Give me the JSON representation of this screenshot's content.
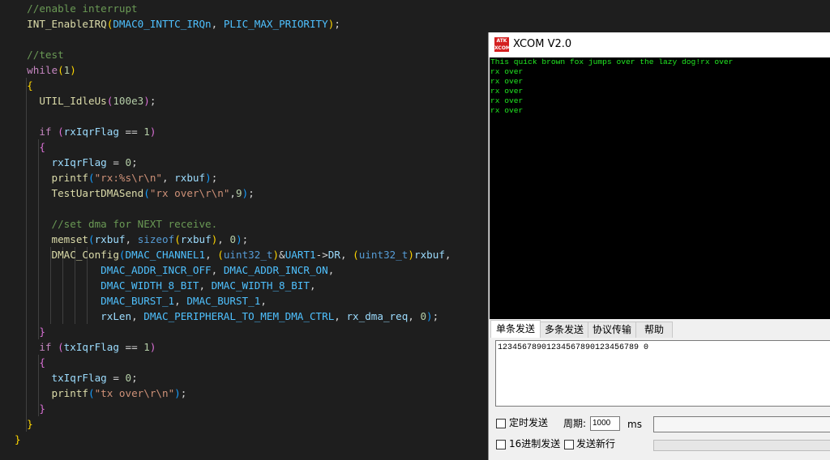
{
  "editor": {
    "lines": [
      [
        {
          "t": "  //enable interrupt",
          "c": "cm"
        }
      ],
      [
        {
          "t": "  INT_EnableIRQ",
          "c": "fn"
        },
        {
          "t": "(",
          "c": "b1"
        },
        {
          "t": "DMAC0_INTTC_IRQn",
          "c": "mac"
        },
        {
          "t": ", ",
          "c": "pl"
        },
        {
          "t": "PLIC_MAX_PRIORITY",
          "c": "mac"
        },
        {
          "t": ")",
          "c": "b1"
        },
        {
          "t": ";",
          "c": "pl"
        }
      ],
      [],
      [
        {
          "t": "  //test",
          "c": "cm"
        }
      ],
      [
        {
          "t": "  while",
          "c": "kw"
        },
        {
          "t": "(",
          "c": "b1"
        },
        {
          "t": "1",
          "c": "num"
        },
        {
          "t": ")",
          "c": "b1"
        }
      ],
      [
        {
          "t": "  {",
          "c": "b1"
        }
      ],
      [
        {
          "t": "    UTIL_IdleUs",
          "c": "fn"
        },
        {
          "t": "(",
          "c": "b2"
        },
        {
          "t": "100e3",
          "c": "num"
        },
        {
          "t": ")",
          "c": "b2"
        },
        {
          "t": ";",
          "c": "pl"
        }
      ],
      [],
      [
        {
          "t": "    if ",
          "c": "kw"
        },
        {
          "t": "(",
          "c": "b2"
        },
        {
          "t": "rxIqrFlag",
          "c": "var"
        },
        {
          "t": " == ",
          "c": "pl"
        },
        {
          "t": "1",
          "c": "num"
        },
        {
          "t": ")",
          "c": "b2"
        }
      ],
      [
        {
          "t": "    {",
          "c": "b2"
        }
      ],
      [
        {
          "t": "      rxIqrFlag",
          "c": "var"
        },
        {
          "t": " = ",
          "c": "pl"
        },
        {
          "t": "0",
          "c": "num"
        },
        {
          "t": ";",
          "c": "pl"
        }
      ],
      [
        {
          "t": "      printf",
          "c": "fn"
        },
        {
          "t": "(",
          "c": "b3"
        },
        {
          "t": "\"rx:%s\\r\\n\"",
          "c": "str"
        },
        {
          "t": ", ",
          "c": "pl"
        },
        {
          "t": "rxbuf",
          "c": "var"
        },
        {
          "t": ")",
          "c": "b3"
        },
        {
          "t": ";",
          "c": "pl"
        }
      ],
      [
        {
          "t": "      TestUartDMASend",
          "c": "fn"
        },
        {
          "t": "(",
          "c": "b3"
        },
        {
          "t": "\"rx over\\r\\n\"",
          "c": "str"
        },
        {
          "t": ",",
          "c": "pl"
        },
        {
          "t": "9",
          "c": "num"
        },
        {
          "t": ")",
          "c": "b3"
        },
        {
          "t": ";",
          "c": "pl"
        }
      ],
      [],
      [
        {
          "t": "      //set dma for NEXT receive.",
          "c": "cm"
        }
      ],
      [
        {
          "t": "      memset",
          "c": "fn"
        },
        {
          "t": "(",
          "c": "b3"
        },
        {
          "t": "rxbuf",
          "c": "var"
        },
        {
          "t": ", ",
          "c": "pl"
        },
        {
          "t": "sizeof",
          "c": "ty"
        },
        {
          "t": "(",
          "c": "b1"
        },
        {
          "t": "rxbuf",
          "c": "var"
        },
        {
          "t": ")",
          "c": "b1"
        },
        {
          "t": ", ",
          "c": "pl"
        },
        {
          "t": "0",
          "c": "num"
        },
        {
          "t": ")",
          "c": "b3"
        },
        {
          "t": ";",
          "c": "pl"
        }
      ],
      [
        {
          "t": "      DMAC_Config",
          "c": "fn"
        },
        {
          "t": "(",
          "c": "b3"
        },
        {
          "t": "DMAC_CHANNEL1",
          "c": "mac"
        },
        {
          "t": ", ",
          "c": "pl"
        },
        {
          "t": "(",
          "c": "b1"
        },
        {
          "t": "uint32_t",
          "c": "ty"
        },
        {
          "t": ")",
          "c": "b1"
        },
        {
          "t": "&",
          "c": "pl"
        },
        {
          "t": "UART1",
          "c": "mac"
        },
        {
          "t": "->",
          "c": "pl"
        },
        {
          "t": "DR",
          "c": "var"
        },
        {
          "t": ", ",
          "c": "pl"
        },
        {
          "t": "(",
          "c": "b1"
        },
        {
          "t": "uint32_t",
          "c": "ty"
        },
        {
          "t": ")",
          "c": "b1"
        },
        {
          "t": "rxbuf",
          "c": "var"
        },
        {
          "t": ",",
          "c": "pl"
        }
      ],
      [
        {
          "t": "              DMAC_ADDR_INCR_OFF",
          "c": "mac"
        },
        {
          "t": ", ",
          "c": "pl"
        },
        {
          "t": "DMAC_ADDR_INCR_ON",
          "c": "mac"
        },
        {
          "t": ",",
          "c": "pl"
        }
      ],
      [
        {
          "t": "              DMAC_WIDTH_8_BIT",
          "c": "mac"
        },
        {
          "t": ", ",
          "c": "pl"
        },
        {
          "t": "DMAC_WIDTH_8_BIT",
          "c": "mac"
        },
        {
          "t": ",",
          "c": "pl"
        }
      ],
      [
        {
          "t": "              DMAC_BURST_1",
          "c": "mac"
        },
        {
          "t": ", ",
          "c": "pl"
        },
        {
          "t": "DMAC_BURST_1",
          "c": "mac"
        },
        {
          "t": ",",
          "c": "pl"
        }
      ],
      [
        {
          "t": "              rxLen",
          "c": "var"
        },
        {
          "t": ", ",
          "c": "pl"
        },
        {
          "t": "DMAC_PERIPHERAL_TO_MEM_DMA_CTRL",
          "c": "mac"
        },
        {
          "t": ", ",
          "c": "pl"
        },
        {
          "t": "rx_dma_req",
          "c": "var"
        },
        {
          "t": ", ",
          "c": "pl"
        },
        {
          "t": "0",
          "c": "num"
        },
        {
          "t": ")",
          "c": "b3"
        },
        {
          "t": ";",
          "c": "pl"
        }
      ],
      [
        {
          "t": "    }",
          "c": "b2"
        }
      ],
      [
        {
          "t": "    if ",
          "c": "kw"
        },
        {
          "t": "(",
          "c": "b2"
        },
        {
          "t": "txIqrFlag",
          "c": "var"
        },
        {
          "t": " == ",
          "c": "pl"
        },
        {
          "t": "1",
          "c": "num"
        },
        {
          "t": ")",
          "c": "b2"
        }
      ],
      [
        {
          "t": "    {",
          "c": "b2"
        }
      ],
      [
        {
          "t": "      txIqrFlag",
          "c": "var"
        },
        {
          "t": " = ",
          "c": "pl"
        },
        {
          "t": "0",
          "c": "num"
        },
        {
          "t": ";",
          "c": "pl"
        }
      ],
      [
        {
          "t": "      printf",
          "c": "fn"
        },
        {
          "t": "(",
          "c": "b3"
        },
        {
          "t": "\"tx over\\r\\n\"",
          "c": "str"
        },
        {
          "t": ")",
          "c": "b3"
        },
        {
          "t": ";",
          "c": "pl"
        }
      ],
      [
        {
          "t": "    }",
          "c": "b2"
        }
      ],
      [
        {
          "t": "  }",
          "c": "b1"
        }
      ],
      [
        {
          "t": "}",
          "c": "b1"
        }
      ]
    ]
  },
  "xcom": {
    "logo_text": "ATK XCOM",
    "title": "XCOM V2.0",
    "receive_lines": [
      "This quick brown fox jumps over the lazy dog!rx over",
      "rx over",
      "rx over",
      "rx over",
      "rx over",
      "rx over"
    ],
    "tabs": [
      "单条发送",
      "多条发送",
      "协议传输",
      "帮助"
    ],
    "send_text": "12345678901234567890123456789 0",
    "timed_send_label": "定时发送",
    "period_label": "周期:",
    "period_value": "1000",
    "period_unit": "ms",
    "hex_send_label": "16进制发送",
    "newline_label": "发送新行"
  }
}
